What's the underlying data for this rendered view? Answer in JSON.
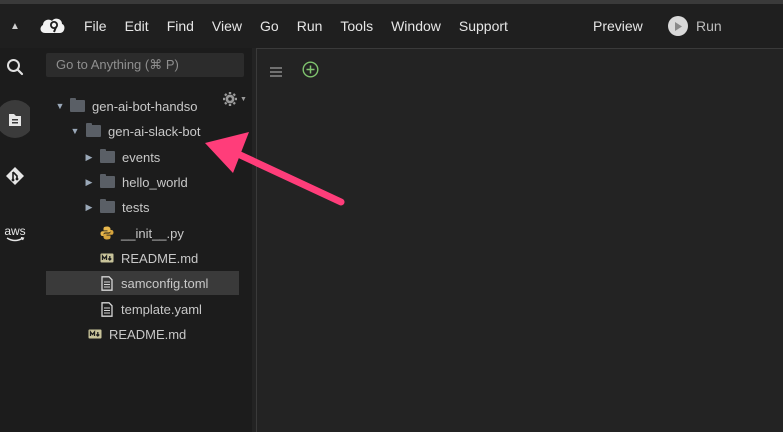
{
  "menubar": {
    "items": [
      "File",
      "Edit",
      "Find",
      "View",
      "Go",
      "Run",
      "Tools",
      "Window",
      "Support"
    ],
    "preview_label": "Preview",
    "run_label": "Run"
  },
  "activity_bar": {
    "icons": [
      "search-icon",
      "files-icon",
      "git-icon",
      "aws-icon"
    ],
    "aws_text": "aws"
  },
  "sidebar": {
    "goto_placeholder": "Go to Anything (⌘ P)",
    "tree": [
      {
        "label": "gen-ai-bot-handso",
        "type": "folder",
        "expanded": true,
        "depth": 0
      },
      {
        "label": "gen-ai-slack-bot",
        "type": "folder",
        "expanded": true,
        "depth": 1
      },
      {
        "label": "events",
        "type": "folder",
        "expanded": false,
        "depth": 2
      },
      {
        "label": "hello_world",
        "type": "folder",
        "expanded": false,
        "depth": 2
      },
      {
        "label": "tests",
        "type": "folder",
        "expanded": false,
        "depth": 2
      },
      {
        "label": "__init__.py",
        "type": "python",
        "depth": 2
      },
      {
        "label": "README.md",
        "type": "markdown",
        "depth": 2
      },
      {
        "label": "samconfig.toml",
        "type": "file",
        "depth": 2,
        "selected": true
      },
      {
        "label": "template.yaml",
        "type": "file",
        "depth": 2
      },
      {
        "label": "README.md",
        "type": "markdown",
        "depth": 1
      }
    ]
  },
  "annotation": {
    "arrow_color": "#ff3d7a"
  }
}
